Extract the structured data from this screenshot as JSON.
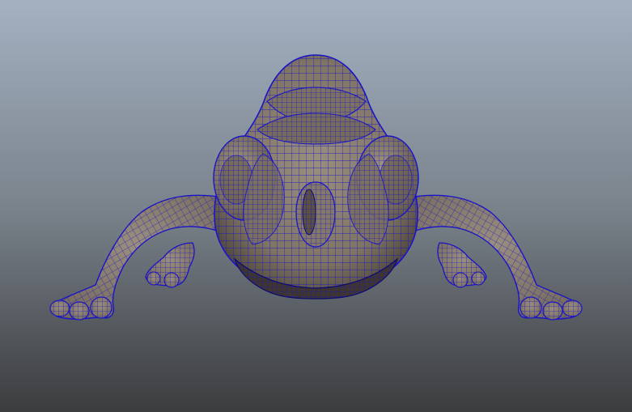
{
  "viewport": {
    "background_top_color": "#a3b1c1",
    "background_mid_color": "#7a838c",
    "background_bottom_color": "#3b3c3e",
    "mesh_surface_color": "#8c8070",
    "mesh_shadow_color": "#4a4038",
    "wireframe_color": "#1a14c8",
    "wireframe_dark_color": "#0c0a6e",
    "object_name": "chameleon-mesh"
  }
}
